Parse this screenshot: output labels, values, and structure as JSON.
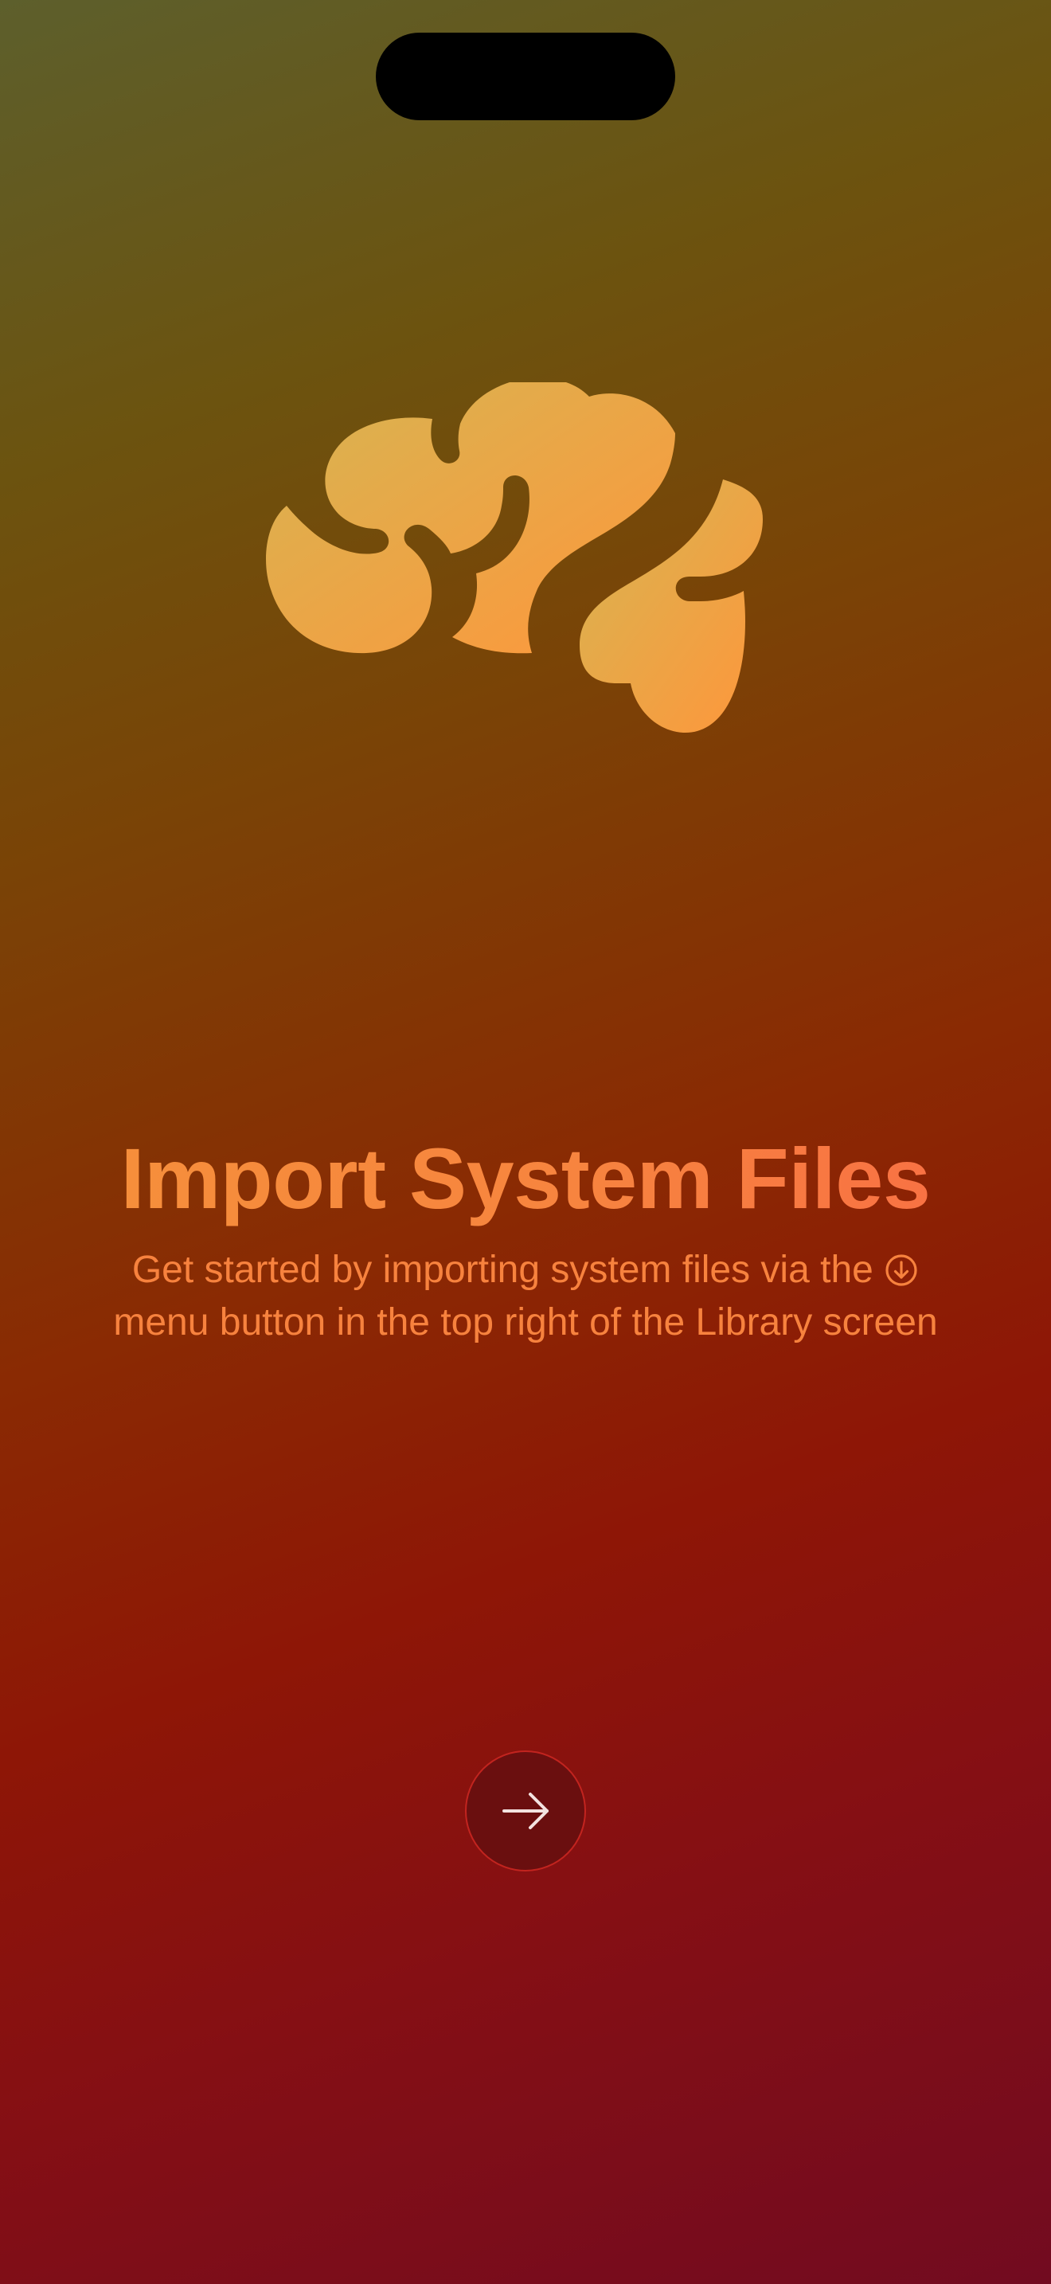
{
  "onboarding": {
    "title": "Import System Files",
    "subtitle_line1": "Get started by importing system files via the",
    "subtitle_line2": "menu button in the top right of the Library screen",
    "inline_icon": "arrow-down-circle-icon",
    "hero_icon": "brain-icon",
    "next_button_icon": "arrow-right-icon"
  },
  "colors": {
    "brain_gradient_start": "#d6b552",
    "brain_gradient_end": "#ff963b",
    "title_color": "#f6913a",
    "subtitle_color": "#f7823e",
    "button_fill": "#6a0f0f",
    "button_ring": "#c2241f"
  }
}
